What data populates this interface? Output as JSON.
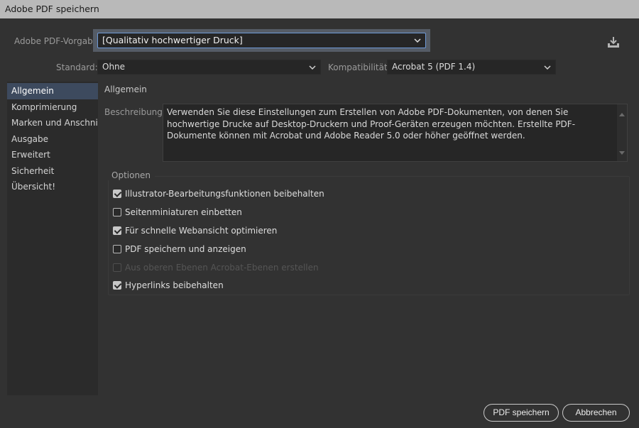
{
  "window": {
    "title": "Adobe PDF speichern"
  },
  "preset": {
    "label": "Adobe PDF-Vorgabe:",
    "value": "[Qualitativ hochwertiger Druck]"
  },
  "standard": {
    "label": "Standard:",
    "value": "Ohne"
  },
  "compatibility": {
    "label": "Kompatibilität:",
    "value": "Acrobat 5 (PDF 1.4)"
  },
  "sidebar": {
    "items": [
      {
        "label": "Allgemein",
        "active": true
      },
      {
        "label": "Komprimierung"
      },
      {
        "label": "Marken und Anschnitt"
      },
      {
        "label": "Ausgabe"
      },
      {
        "label": "Erweitert"
      },
      {
        "label": "Sicherheit"
      },
      {
        "label": "Übersicht!"
      }
    ]
  },
  "main": {
    "section_title": "Allgemein",
    "description_label": "Beschreibung:",
    "description": "Verwenden Sie diese Einstellungen zum Erstellen von Adobe PDF-Dokumenten, von denen Sie hochwertige Drucke auf Desktop-Druckern und Proof-Geräten erzeugen möchten. Erstellte PDF-Dokumente können mit Acrobat und Adobe Reader 5.0 oder höher geöffnet werden.",
    "options_title": "Optionen",
    "options": [
      {
        "label": "Illustrator-Bearbeitungsfunktionen beibehalten",
        "checked": true,
        "enabled": true
      },
      {
        "label": "Seitenminiaturen einbetten",
        "checked": false,
        "enabled": true
      },
      {
        "label": "Für schnelle Webansicht optimieren",
        "checked": true,
        "enabled": true
      },
      {
        "label": "PDF speichern und anzeigen",
        "checked": false,
        "enabled": true
      },
      {
        "label": "Aus oberen Ebenen Acrobat-Ebenen erstellen",
        "checked": false,
        "enabled": false
      },
      {
        "label": "Hyperlinks beibehalten",
        "checked": true,
        "enabled": true
      }
    ]
  },
  "buttons": {
    "save": "PDF speichern",
    "cancel": "Abbrechen"
  },
  "icons": {
    "preset_save": "download-icon",
    "dropdown": "chevron-down-icon"
  },
  "colors": {
    "background": "#323232",
    "titlebar": "#b9b9b9",
    "focus": "#6f9bd8",
    "selection": "#3d4a5e"
  }
}
